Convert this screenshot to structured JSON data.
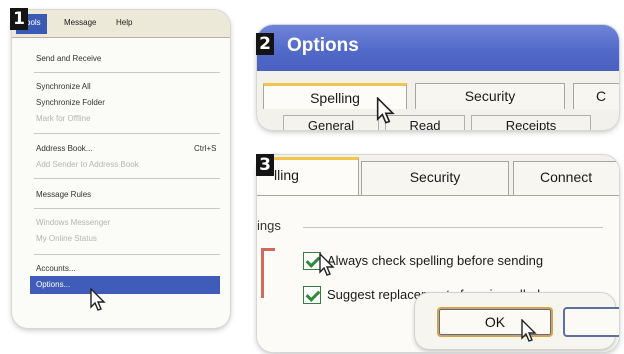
{
  "steps": [
    "1",
    "2",
    "3"
  ],
  "menu": {
    "bar": [
      "Tools",
      "Message",
      "Help"
    ],
    "items": [
      {
        "label": "Send and Receive",
        "disabled": false
      },
      {
        "label": "Synchronize All",
        "disabled": false
      },
      {
        "label": "Synchronize Folder",
        "disabled": false
      },
      {
        "label": "Mark for Offline",
        "disabled": true
      },
      {
        "label": "Address Book...",
        "shortcut": "Ctrl+S",
        "disabled": false
      },
      {
        "label": "Add Sender to Address Book",
        "disabled": true
      },
      {
        "label": "Message Rules",
        "disabled": false
      },
      {
        "label": "Windows Messenger",
        "disabled": true
      },
      {
        "label": "My Online Status",
        "disabled": true
      },
      {
        "label": "Accounts...",
        "disabled": false
      },
      {
        "label": "Options...",
        "disabled": false,
        "highlighted": true
      }
    ]
  },
  "dialog": {
    "title": "Options",
    "tabs_top": [
      "Spelling",
      "Security",
      "C"
    ],
    "tabs_bottom": [
      "General",
      "Read",
      "Receipts"
    ],
    "tabs_step3": [
      "lling",
      "Security",
      "Connect"
    ],
    "group_label": "ings",
    "checkboxes": [
      {
        "label": "Always check spelling before sending",
        "checked": true
      },
      {
        "label": "Suggest replacements for misspelled w",
        "checked": true
      }
    ],
    "ok_label": "OK"
  },
  "colors": {
    "titlebar": "#5068c8",
    "menu_highlight": "#3f5cb8",
    "active_tab_accent": "#f3c64b"
  }
}
